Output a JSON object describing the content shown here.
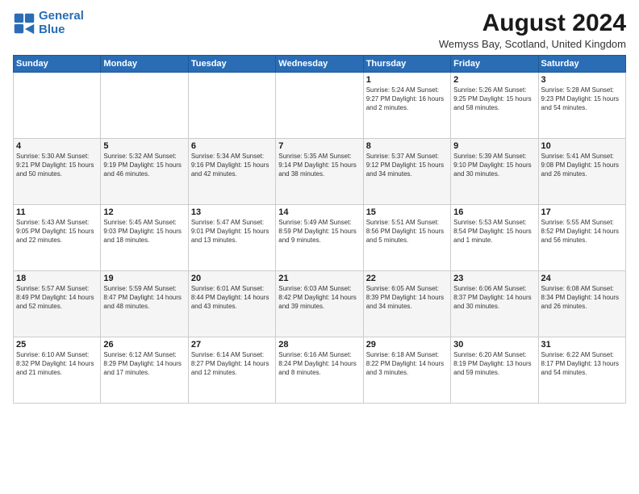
{
  "logo": {
    "line1": "General",
    "line2": "Blue"
  },
  "title": "August 2024",
  "subtitle": "Wemyss Bay, Scotland, United Kingdom",
  "weekdays": [
    "Sunday",
    "Monday",
    "Tuesday",
    "Wednesday",
    "Thursday",
    "Friday",
    "Saturday"
  ],
  "weeks": [
    [
      {
        "day": "",
        "detail": ""
      },
      {
        "day": "",
        "detail": ""
      },
      {
        "day": "",
        "detail": ""
      },
      {
        "day": "",
        "detail": ""
      },
      {
        "day": "1",
        "detail": "Sunrise: 5:24 AM\nSunset: 9:27 PM\nDaylight: 16 hours\nand 2 minutes."
      },
      {
        "day": "2",
        "detail": "Sunrise: 5:26 AM\nSunset: 9:25 PM\nDaylight: 15 hours\nand 58 minutes."
      },
      {
        "day": "3",
        "detail": "Sunrise: 5:28 AM\nSunset: 9:23 PM\nDaylight: 15 hours\nand 54 minutes."
      }
    ],
    [
      {
        "day": "4",
        "detail": "Sunrise: 5:30 AM\nSunset: 9:21 PM\nDaylight: 15 hours\nand 50 minutes."
      },
      {
        "day": "5",
        "detail": "Sunrise: 5:32 AM\nSunset: 9:19 PM\nDaylight: 15 hours\nand 46 minutes."
      },
      {
        "day": "6",
        "detail": "Sunrise: 5:34 AM\nSunset: 9:16 PM\nDaylight: 15 hours\nand 42 minutes."
      },
      {
        "day": "7",
        "detail": "Sunrise: 5:35 AM\nSunset: 9:14 PM\nDaylight: 15 hours\nand 38 minutes."
      },
      {
        "day": "8",
        "detail": "Sunrise: 5:37 AM\nSunset: 9:12 PM\nDaylight: 15 hours\nand 34 minutes."
      },
      {
        "day": "9",
        "detail": "Sunrise: 5:39 AM\nSunset: 9:10 PM\nDaylight: 15 hours\nand 30 minutes."
      },
      {
        "day": "10",
        "detail": "Sunrise: 5:41 AM\nSunset: 9:08 PM\nDaylight: 15 hours\nand 26 minutes."
      }
    ],
    [
      {
        "day": "11",
        "detail": "Sunrise: 5:43 AM\nSunset: 9:05 PM\nDaylight: 15 hours\nand 22 minutes."
      },
      {
        "day": "12",
        "detail": "Sunrise: 5:45 AM\nSunset: 9:03 PM\nDaylight: 15 hours\nand 18 minutes."
      },
      {
        "day": "13",
        "detail": "Sunrise: 5:47 AM\nSunset: 9:01 PM\nDaylight: 15 hours\nand 13 minutes."
      },
      {
        "day": "14",
        "detail": "Sunrise: 5:49 AM\nSunset: 8:59 PM\nDaylight: 15 hours\nand 9 minutes."
      },
      {
        "day": "15",
        "detail": "Sunrise: 5:51 AM\nSunset: 8:56 PM\nDaylight: 15 hours\nand 5 minutes."
      },
      {
        "day": "16",
        "detail": "Sunrise: 5:53 AM\nSunset: 8:54 PM\nDaylight: 15 hours\nand 1 minute."
      },
      {
        "day": "17",
        "detail": "Sunrise: 5:55 AM\nSunset: 8:52 PM\nDaylight: 14 hours\nand 56 minutes."
      }
    ],
    [
      {
        "day": "18",
        "detail": "Sunrise: 5:57 AM\nSunset: 8:49 PM\nDaylight: 14 hours\nand 52 minutes."
      },
      {
        "day": "19",
        "detail": "Sunrise: 5:59 AM\nSunset: 8:47 PM\nDaylight: 14 hours\nand 48 minutes."
      },
      {
        "day": "20",
        "detail": "Sunrise: 6:01 AM\nSunset: 8:44 PM\nDaylight: 14 hours\nand 43 minutes."
      },
      {
        "day": "21",
        "detail": "Sunrise: 6:03 AM\nSunset: 8:42 PM\nDaylight: 14 hours\nand 39 minutes."
      },
      {
        "day": "22",
        "detail": "Sunrise: 6:05 AM\nSunset: 8:39 PM\nDaylight: 14 hours\nand 34 minutes."
      },
      {
        "day": "23",
        "detail": "Sunrise: 6:06 AM\nSunset: 8:37 PM\nDaylight: 14 hours\nand 30 minutes."
      },
      {
        "day": "24",
        "detail": "Sunrise: 6:08 AM\nSunset: 8:34 PM\nDaylight: 14 hours\nand 26 minutes."
      }
    ],
    [
      {
        "day": "25",
        "detail": "Sunrise: 6:10 AM\nSunset: 8:32 PM\nDaylight: 14 hours\nand 21 minutes."
      },
      {
        "day": "26",
        "detail": "Sunrise: 6:12 AM\nSunset: 8:29 PM\nDaylight: 14 hours\nand 17 minutes."
      },
      {
        "day": "27",
        "detail": "Sunrise: 6:14 AM\nSunset: 8:27 PM\nDaylight: 14 hours\nand 12 minutes."
      },
      {
        "day": "28",
        "detail": "Sunrise: 6:16 AM\nSunset: 8:24 PM\nDaylight: 14 hours\nand 8 minutes."
      },
      {
        "day": "29",
        "detail": "Sunrise: 6:18 AM\nSunset: 8:22 PM\nDaylight: 14 hours\nand 3 minutes."
      },
      {
        "day": "30",
        "detail": "Sunrise: 6:20 AM\nSunset: 8:19 PM\nDaylight: 13 hours\nand 59 minutes."
      },
      {
        "day": "31",
        "detail": "Sunrise: 6:22 AM\nSunset: 8:17 PM\nDaylight: 13 hours\nand 54 minutes."
      }
    ]
  ]
}
